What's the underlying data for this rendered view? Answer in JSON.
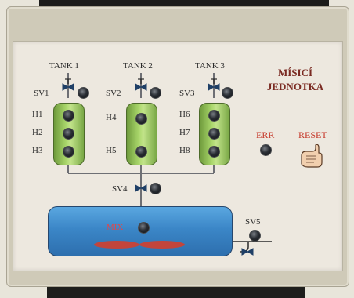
{
  "title": {
    "line1": "MÍSICÍ",
    "line2": "JEDNOTKA"
  },
  "tanks": [
    {
      "label": "TANK 1",
      "valve": "SV1",
      "sensors": [
        "H1",
        "H2",
        "H3"
      ]
    },
    {
      "label": "TANK 2",
      "valve": "SV2",
      "sensors": [
        "H4",
        "H5"
      ]
    },
    {
      "label": "TANK 3",
      "valve": "SV3",
      "sensors": [
        "H6",
        "H7",
        "H8"
      ]
    }
  ],
  "mix": {
    "valve": "SV4",
    "label": "MIX",
    "outlet_valve": "SV5"
  },
  "controls": {
    "error_label": "ERR",
    "reset_label": "RESET",
    "reset_icon": "hand-pointing-icon"
  },
  "colors": {
    "tank_fill": "#9ccc5e",
    "mix_fill": "#3b86c7",
    "label_red": "#c63a2c",
    "title_red": "#7a2a22"
  }
}
